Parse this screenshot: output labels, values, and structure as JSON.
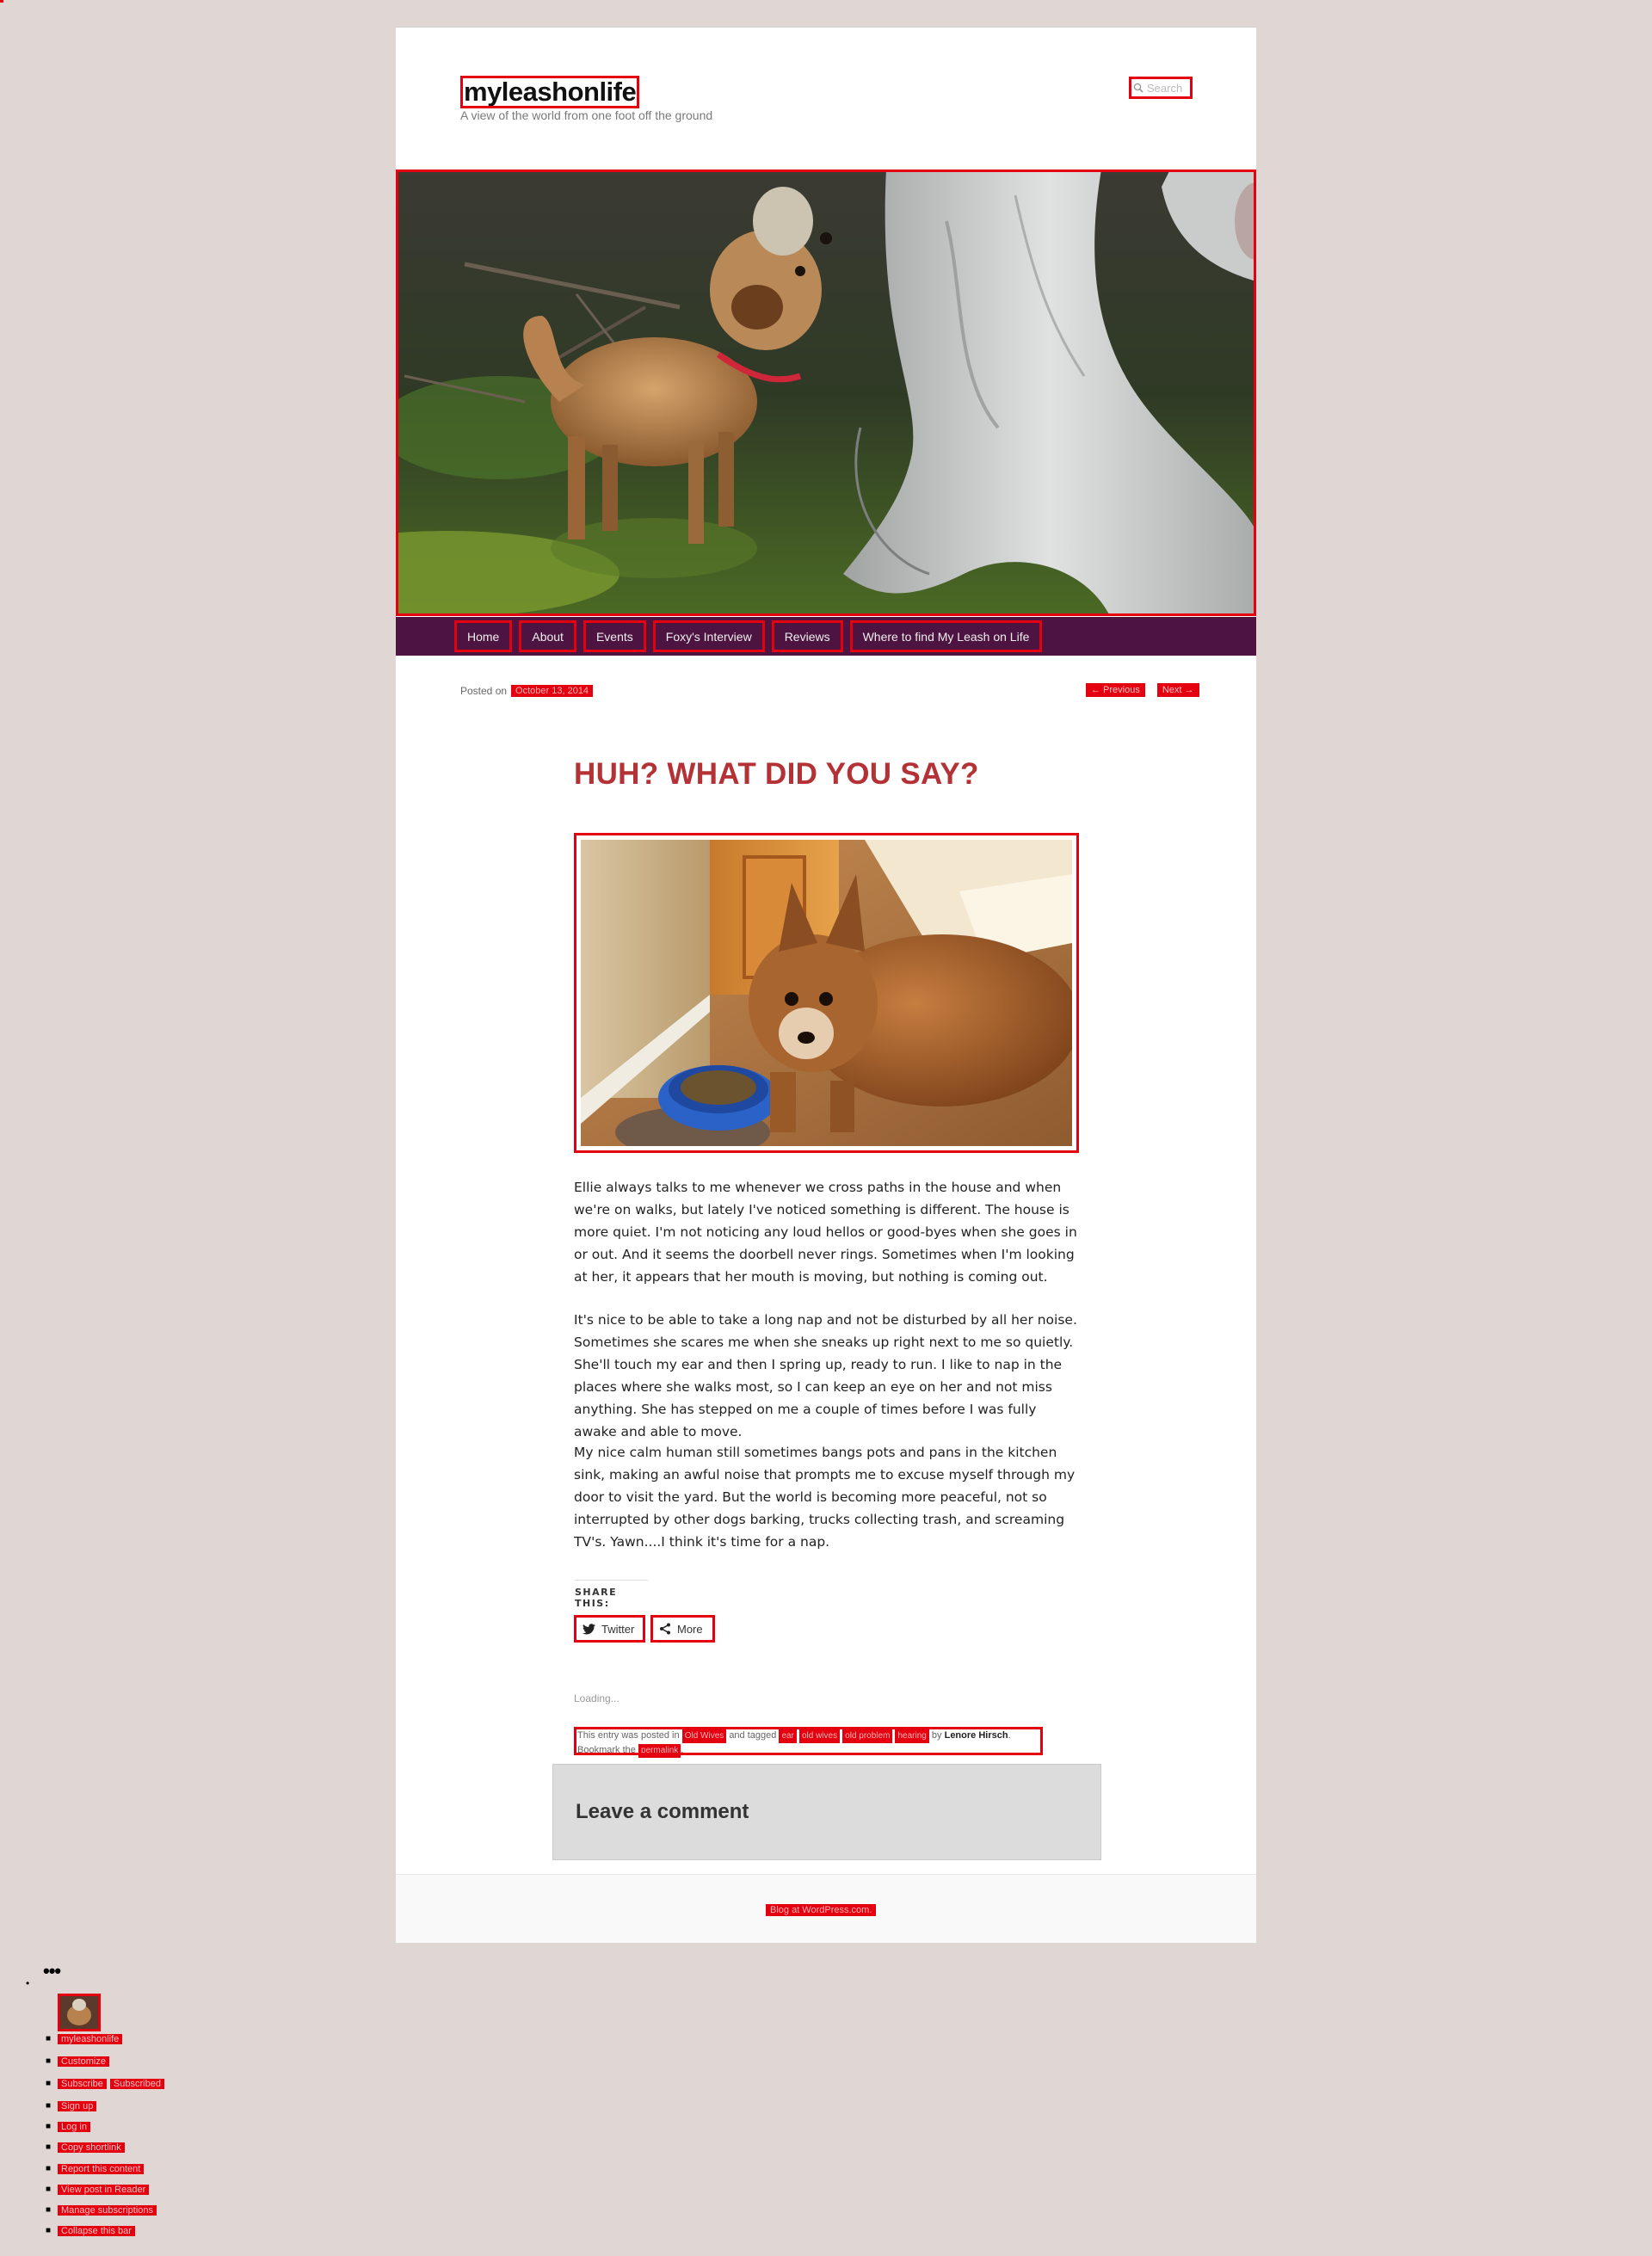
{
  "site": {
    "title": "myleashonlife",
    "description": "A view of the world from one foot off the ground",
    "search_placeholder": "Search"
  },
  "nav": {
    "items": [
      "Home",
      "About",
      "Events",
      "Foxy's Interview",
      "Reviews",
      "Where to find My Leash on Life"
    ]
  },
  "post": {
    "posted_on_label": "Posted on",
    "date": "October 13, 2014",
    "prev_label": "← Previous",
    "next_label": "Next →",
    "title": "HUH? WHAT DID YOU SAY?",
    "paragraphs": [
      "Ellie always talks to me whenever we cross paths in the house and when we're on walks, but lately I've noticed something is different. The house is more quiet. I'm not noticing any loud hellos or good-byes when she goes in or out. And it seems the doorbell never rings. Sometimes when I'm looking at her, it appears that her mouth is moving, but nothing is coming out.",
      "It's nice to be able to take a long nap and not be disturbed by all her noise. Sometimes she scares me when she sneaks up right next to me so quietly. She'll touch my ear and then I spring up, ready to run. I like to nap in the places where she walks most, so I can keep an eye on her and not miss anything. She has stepped on me a couple of times before I was fully awake and able to move.",
      "My nice calm human still sometimes bangs pots and pans in the kitchen sink, making an awful noise that prompts me to excuse myself through my door to visit the yard. But the world is becoming more peaceful, not so interrupted by other dogs barking, trucks collecting trash, and screaming TV's. Yawn....I think it's time for a nap."
    ],
    "share_title": "SHARE THIS:",
    "share_twitter": "Twitter",
    "share_more": "More",
    "loading": "Loading...",
    "meta": {
      "prefix": "This entry was posted in",
      "category": "Old Wives",
      "tagged": "and tagged",
      "tags": [
        "ear",
        "old wives",
        "old problem",
        "hearing"
      ],
      "by": "by",
      "author": "Lenore Hirsch",
      "bookmark": ". Bookmark the",
      "permalink": "permalink",
      "end": "."
    }
  },
  "comments": {
    "heading": "Leave a comment"
  },
  "footer": {
    "link": "Blog at WordPress.com."
  },
  "admin_bar": {
    "ellipsis": "•••",
    "items": [
      "myleashonlife",
      "Customize",
      "Subscribe",
      "Subscribed",
      "Sign up",
      "Log in",
      "Copy shortlink",
      "Report this content",
      "View post in Reader",
      "Manage subscriptions",
      "Collapse this bar"
    ]
  },
  "colors": {
    "background": "#e0d6d4",
    "nav": "#4d1442",
    "title_red": "#b43236",
    "highlight": "#e4000f"
  }
}
